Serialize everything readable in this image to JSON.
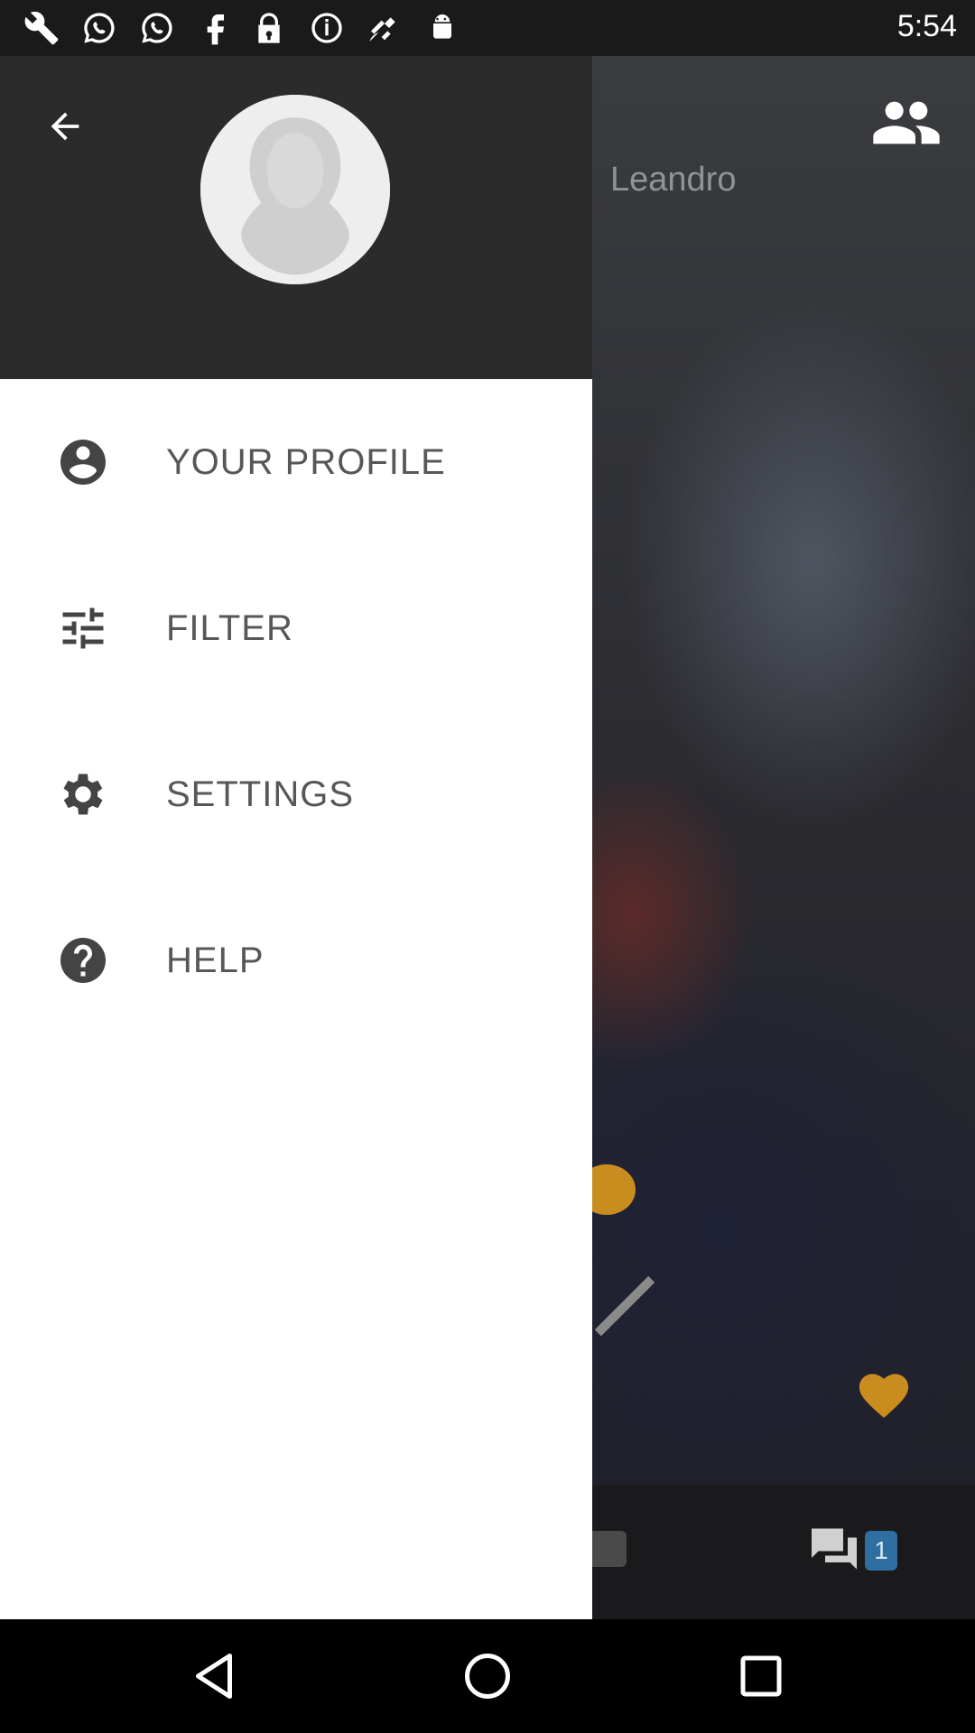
{
  "status_bar": {
    "time": "5:54",
    "icons": [
      "wrench-icon",
      "whatsapp-icon",
      "whatsapp-icon",
      "facebook-icon",
      "lock-icon",
      "info-icon",
      "fake-gps-icon",
      "android-icon"
    ]
  },
  "drawer": {
    "back_icon": "arrow-back-icon",
    "avatar_icon": "default-avatar-silhouette",
    "items": [
      {
        "label": "YOUR PROFILE",
        "icon": "account-circle-icon"
      },
      {
        "label": "FILTER",
        "icon": "sliders-icon"
      },
      {
        "label": "SETTINGS",
        "icon": "gear-icon"
      },
      {
        "label": "HELP",
        "icon": "help-circle-icon"
      }
    ]
  },
  "background": {
    "names_text": "Leandro",
    "group_icon": "group-icon",
    "heart_icon": "heart-icon",
    "chat_icon": "chat-icon",
    "chat_badge": "1",
    "accent_color": "#c98c1e"
  },
  "nav": {
    "back": "nav-back-icon",
    "home": "nav-home-icon",
    "recents": "nav-recents-icon"
  }
}
